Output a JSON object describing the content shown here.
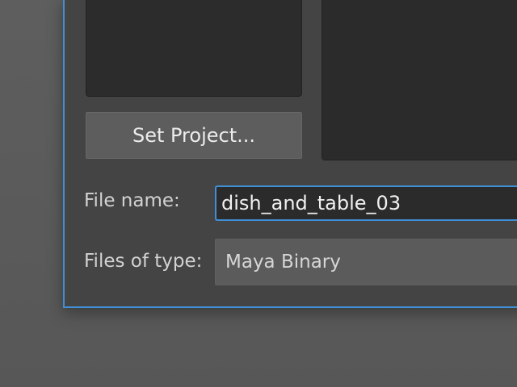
{
  "dialog": {
    "set_project_button": "Set Project...",
    "file_name_label": "File name:",
    "file_name_value": "dish_and_table_03",
    "files_of_type_label": "Files of type:",
    "files_of_type_value": "Maya Binary"
  },
  "colors": {
    "accent": "#3f8fd6",
    "dialog_bg": "#444444",
    "panel_bg": "#2c2c2c",
    "desktop_bg": "#5c5c5c"
  }
}
